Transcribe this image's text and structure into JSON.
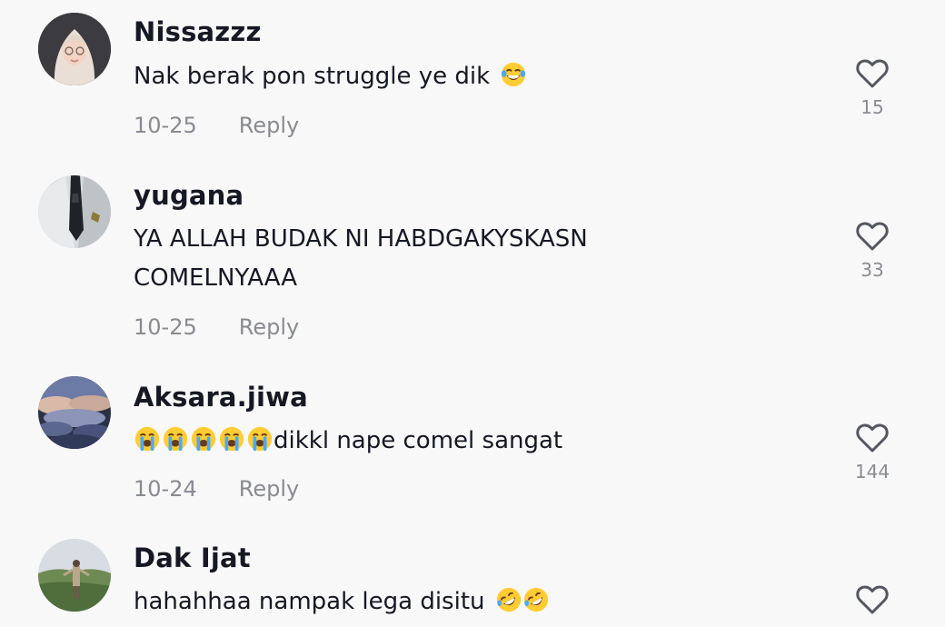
{
  "comments": [
    {
      "username": "Nissazzz",
      "text": "Nak berak pon struggle ye dik",
      "text_suffix_emoji": [
        "face-with-tears-of-joy"
      ],
      "date": "10-25",
      "reply_label": "Reply",
      "likes": "15",
      "avatar": "woman-in-hijab-avatar"
    },
    {
      "username": "yugana",
      "text": "YA ALLAH BUDAK NI HABDGAKYSKASN COMELNYAAA",
      "date": "10-25",
      "reply_label": "Reply",
      "likes": "33",
      "avatar": "shirt-and-tie-avatar"
    },
    {
      "username": "Aksara.jiwa",
      "text_prefix_emoji": [
        "loudly-crying-face",
        "loudly-crying-face",
        "loudly-crying-face",
        "loudly-crying-face",
        "loudly-crying-face"
      ],
      "text": "dikkl nape comel sangat",
      "date": "10-24",
      "reply_label": "Reply",
      "likes": "144",
      "avatar": "cloudy-sky-avatar"
    },
    {
      "username": "Dak Ijat",
      "text": "hahahhaa nampak lega disitu",
      "text_suffix_emoji": [
        "rolling-on-the-floor-laughing",
        "rolling-on-the-floor-laughing"
      ],
      "avatar": "person-on-hill-avatar"
    }
  ],
  "colors": {
    "background": "#f8f8f8",
    "primary_text": "#161823",
    "secondary_text": "#8a8b91",
    "icon": "#55575f"
  }
}
